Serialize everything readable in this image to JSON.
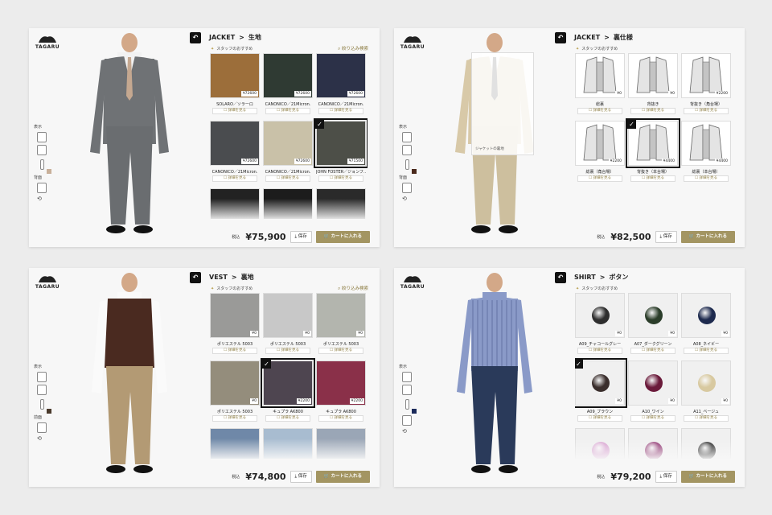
{
  "brand": {
    "name": "TAGARU"
  },
  "panels": [
    {
      "category": "JACKET",
      "section": "生地",
      "subheading": "スタッフのおすすめ",
      "filter_label": "絞り込み検索",
      "side": {
        "label_top": "表示",
        "label_bottom": "背面",
        "swatch": "#c8b09a"
      },
      "total_prefix": "税込",
      "total": "¥75,900",
      "save_label": "保存",
      "cart_label": "カートに入れる",
      "figure": {
        "type": "jacket",
        "color": "#6f7275",
        "pants": "#6a6d70",
        "shirt": "#f2f2f2",
        "tie": "#c5a890"
      },
      "items": [
        {
          "name": "SOLARO／ソラーロ",
          "price": "¥72600",
          "color": "#9c6e3a",
          "detail": "詳細を見る",
          "selected": false
        },
        {
          "name": "CANONICO／21Micron.",
          "price": "¥72600",
          "color": "#2f3a33",
          "detail": "詳細を見る",
          "selected": false
        },
        {
          "name": "CANONICO／21Micron.",
          "price": "¥72600",
          "color": "#2c3148",
          "detail": "詳細を見る",
          "selected": false
        },
        {
          "name": "CANONICO／21Micron.",
          "price": "¥72600",
          "color": "#4a4c4f",
          "detail": "詳細を見る",
          "selected": false
        },
        {
          "name": "CANONICO／21Micron.",
          "price": "¥72600",
          "color": "#c9c1a8",
          "detail": "詳細を見る",
          "selected": false
        },
        {
          "name": "JOHN FOSTER／ジョンフ…",
          "price": "¥71500",
          "color": "#4d4f48",
          "detail": "詳細を見る",
          "selected": true
        },
        {
          "name": "",
          "price": "",
          "color": "#222",
          "detail": "",
          "selected": false
        },
        {
          "name": "",
          "price": "",
          "color": "#1c1c1c",
          "detail": "",
          "selected": false
        },
        {
          "name": "",
          "price": "",
          "color": "#2a2a2a",
          "detail": "",
          "selected": false
        }
      ]
    },
    {
      "category": "JACKET",
      "section": "裏仕様",
      "subheading": "スタッフのおすすめ",
      "filter_label": "",
      "side": {
        "label_top": "表示",
        "label_bottom": "背面",
        "swatch": "#4a2a1c"
      },
      "total_prefix": "税込",
      "total": "¥82,500",
      "save_label": "保存",
      "cart_label": "カートに入れる",
      "popup_label": "ジャケットの裏地",
      "figure": {
        "type": "double",
        "color": "#d8c9a8",
        "pants": "#cdbf9e",
        "shirt": "#fff",
        "tie": "#3a3a3a"
      },
      "items": [
        {
          "name": "総裏",
          "price": "¥0",
          "color": "lining",
          "detail": "詳細を見る",
          "selected": false
        },
        {
          "name": "背抜き",
          "price": "¥0",
          "color": "lining",
          "detail": "詳細を見る",
          "selected": false
        },
        {
          "name": "背抜き（角台場）",
          "price": "¥2200",
          "color": "lining",
          "detail": "詳細を見る",
          "selected": false
        },
        {
          "name": "総裏（角台場）",
          "price": "¥2200",
          "color": "lining",
          "detail": "詳細を見る",
          "selected": false
        },
        {
          "name": "背抜き（本台場）",
          "price": "¥4400",
          "color": "lining",
          "detail": "詳細を見る",
          "selected": true
        },
        {
          "name": "総裏（本台場）",
          "price": "¥4400",
          "color": "lining",
          "detail": "詳細を見る",
          "selected": false
        }
      ]
    },
    {
      "category": "VEST",
      "section": "裏地",
      "subheading": "スタッフのおすすめ",
      "filter_label": "絞り込み検索",
      "side": {
        "label_top": "表示",
        "label_bottom": "前面",
        "swatch": "#4a3a2c"
      },
      "total_prefix": "税込",
      "total": "¥74,800",
      "save_label": "保存",
      "cart_label": "カートに入れる",
      "figure": {
        "type": "vest",
        "color": "#4a2a20",
        "pants": "#b39a74",
        "shirt": "#fafafa",
        "tie": "#fff"
      },
      "items": [
        {
          "name": "ポリエステル 5003",
          "price": "¥0",
          "color": "#9a9a98",
          "detail": "詳細を見る",
          "selected": false
        },
        {
          "name": "ポリエステル 5003",
          "price": "¥0",
          "color": "#c8c8c8",
          "detail": "詳細を見る",
          "selected": false
        },
        {
          "name": "ポリエステル 5003",
          "price": "¥0",
          "color": "#b3b5ae",
          "detail": "詳細を見る",
          "selected": false
        },
        {
          "name": "ポリエステル 5003",
          "price": "¥0",
          "color": "#948d7c",
          "detail": "詳細を見る",
          "selected": false
        },
        {
          "name": "キュプラ AK800",
          "price": "¥2200",
          "color": "#4e4550",
          "detail": "詳細を見る",
          "selected": true
        },
        {
          "name": "キュプラ AK800",
          "price": "¥2200",
          "color": "#8a3049",
          "detail": "詳細を見る",
          "selected": false
        },
        {
          "name": "",
          "price": "",
          "color": "#6f88a8",
          "detail": "",
          "selected": false
        },
        {
          "name": "",
          "price": "",
          "color": "#a8bcd0",
          "detail": "",
          "selected": false
        },
        {
          "name": "",
          "price": "",
          "color": "#9aa6b6",
          "detail": "",
          "selected": false
        }
      ]
    },
    {
      "category": "SHIRT",
      "section": "ボタン",
      "subheading": "スタッフのおすすめ",
      "filter_label": "",
      "side": {
        "label_top": "表示",
        "label_bottom": "",
        "swatch": "#1a2a5a"
      },
      "total_prefix": "税込",
      "total": "¥79,200",
      "save_label": "保存",
      "cart_label": "カートに入れる",
      "figure": {
        "type": "shirt",
        "color": "#8a9ac8",
        "pants": "#2a3a5a",
        "shirt": "#8a9ac8",
        "tie": ""
      },
      "items": [
        {
          "name": "A09_チャコールグレー",
          "price": "¥0",
          "color": "#2e2e2e",
          "detail": "詳細を見る",
          "selected": false
        },
        {
          "name": "A07_ダークグリーン",
          "price": "¥0",
          "color": "#2b3d2a",
          "detail": "詳細を見る",
          "selected": false
        },
        {
          "name": "A08_ネイビー",
          "price": "¥0",
          "color": "#1d2a4e",
          "detail": "詳細を見る",
          "selected": false
        },
        {
          "name": "A09_ブラウン",
          "price": "¥0",
          "color": "#3a2e2c",
          "detail": "詳細を見る",
          "selected": true
        },
        {
          "name": "A10_ワイン",
          "price": "¥0",
          "color": "#6a1a3a",
          "detail": "詳細を見る",
          "selected": false
        },
        {
          "name": "A11_ベージュ",
          "price": "¥0",
          "color": "#d8c9a0",
          "detail": "詳細を見る",
          "selected": false
        },
        {
          "name": "",
          "price": "",
          "color": "#d8a0d0",
          "detail": "",
          "selected": false
        },
        {
          "name": "",
          "price": "",
          "color": "#8a2a6a",
          "detail": "",
          "selected": false
        },
        {
          "name": "",
          "price": "",
          "color": "#1a1a1a",
          "detail": "",
          "selected": false
        }
      ]
    }
  ]
}
